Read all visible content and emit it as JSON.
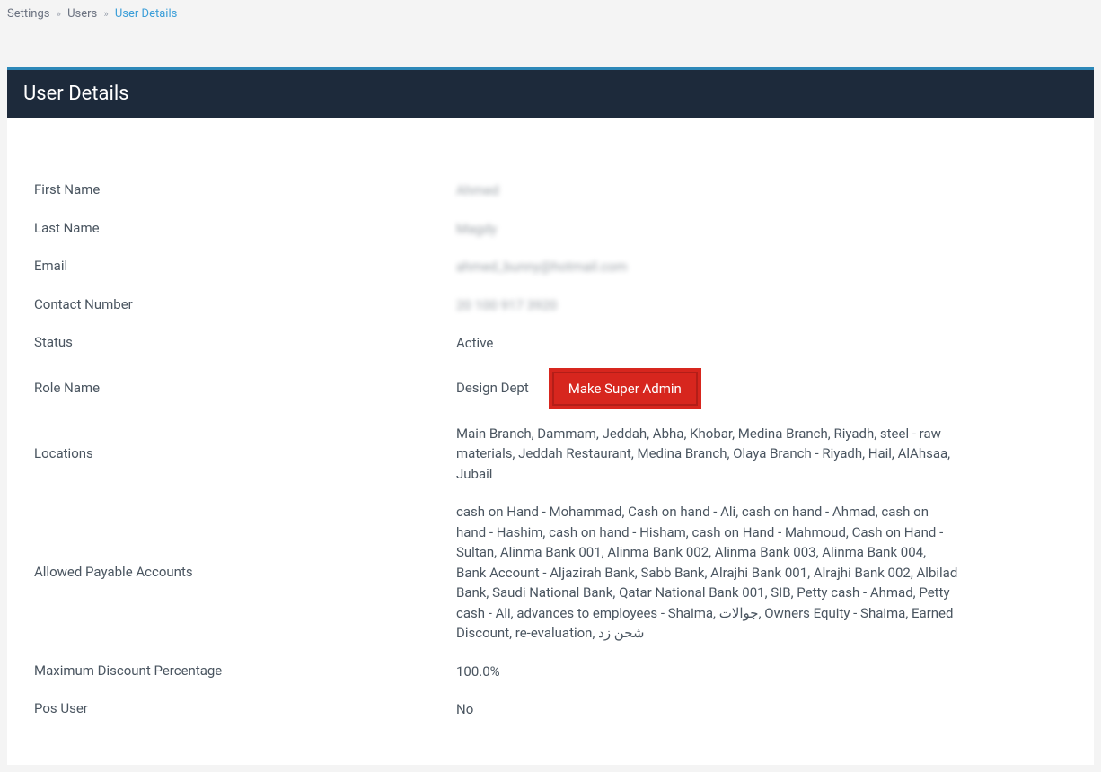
{
  "breadcrumb": {
    "settings": "Settings",
    "users": "Users",
    "current": "User Details"
  },
  "header": {
    "title": "User Details"
  },
  "fields": {
    "first_name": {
      "label": "First Name",
      "value": "Ahmed"
    },
    "last_name": {
      "label": "Last Name",
      "value": "Magdy"
    },
    "email": {
      "label": "Email",
      "value": "ahmed_bunny@hotmail.com"
    },
    "contact_number": {
      "label": "Contact Number",
      "value": "20 100 917 3920"
    },
    "status": {
      "label": "Status",
      "value": "Active"
    },
    "role_name": {
      "label": "Role Name",
      "value": "Design Dept"
    },
    "locations": {
      "label": "Locations",
      "value": "Main Branch, Dammam, Jeddah, Abha, Khobar, Medina Branch, Riyadh, steel - raw materials, Jeddah Restaurant, Medina Branch, Olaya Branch - Riyadh, Hail, AlAhsaa, Jubail"
    },
    "allowed_payable_accounts": {
      "label": "Allowed Payable Accounts",
      "value": "cash on Hand - Mohammad, Cash on hand - Ali, cash on hand - Ahmad, cash on hand - Hashim, cash on hand - Hisham, cash on Hand - Mahmoud, Cash on Hand - Sultan, Alinma Bank 001, Alinma Bank 002, Alinma Bank 003, Alinma Bank 004, Bank Account - Aljazirah Bank, Sabb Bank, Alrajhi Bank 001, Alrajhi Bank 002, Albilad Bank, Saudi National Bank, Qatar National Bank 001, SIB, Petty cash - Ahmad, Petty cash - Ali, advances to employees - Shaima, جوالات, Owners Equity - Shaima, Earned Discount, re-evaluation, شحن زد"
    },
    "max_discount": {
      "label": "Maximum Discount Percentage",
      "value": "100.0%"
    },
    "pos_user": {
      "label": "Pos User",
      "value": "No"
    }
  },
  "actions": {
    "make_super_admin": "Make Super Admin"
  }
}
